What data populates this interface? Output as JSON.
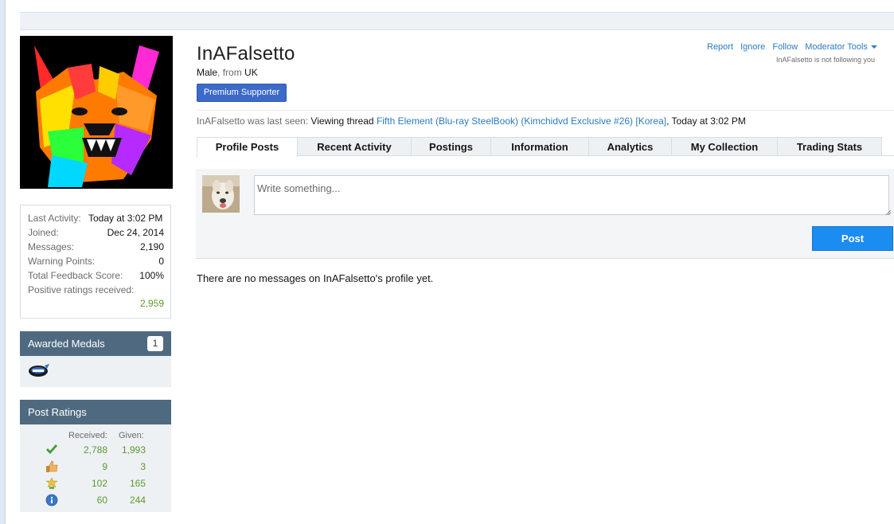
{
  "profile": {
    "username": "InAFalsetto",
    "gender": "Male",
    "from_word": "from",
    "location": "UK",
    "badge": "Premium Supporter"
  },
  "actions": {
    "report": "Report",
    "ignore": "Ignore",
    "follow": "Follow",
    "moderator_tools": "Moderator Tools",
    "following_status": "InAFalsetto is not following you"
  },
  "last_seen": {
    "prefix": "InAFalsetto was last seen:",
    "action": "Viewing thread",
    "thread": "Fifth Element (Blu-ray SteelBook) (Kimchidvd Exclusive #26) [Korea]",
    "time": ", Today at 3:02 PM"
  },
  "tabs": [
    {
      "label": "Profile Posts",
      "active": true
    },
    {
      "label": "Recent Activity"
    },
    {
      "label": "Postings"
    },
    {
      "label": "Information"
    },
    {
      "label": "Analytics"
    },
    {
      "label": "My Collection"
    },
    {
      "label": "Trading Stats"
    }
  ],
  "stats": [
    {
      "label": "Last Activity:",
      "value": "Today at 3:02 PM"
    },
    {
      "label": "Joined:",
      "value": "Dec 24, 2014"
    },
    {
      "label": "Messages:",
      "value": "2,190"
    },
    {
      "label": "Warning Points:",
      "value": "0"
    },
    {
      "label": "Total Feedback Score:",
      "value": "100%"
    },
    {
      "label": "Positive ratings received:",
      "value": "2,959"
    }
  ],
  "medals": {
    "title": "Awarded Medals",
    "count": "1",
    "icon": "medal-icon"
  },
  "ratings": {
    "title": "Post Ratings",
    "received_label": "Received:",
    "given_label": "Given:",
    "rows": [
      {
        "icon": "check-icon",
        "received": "2,788",
        "given": "1,993"
      },
      {
        "icon": "thumbs-up-icon",
        "received": "9",
        "given": "3"
      },
      {
        "icon": "award-icon",
        "received": "102",
        "given": "165"
      },
      {
        "icon": "info-icon",
        "received": "60",
        "given": "244"
      }
    ]
  },
  "composer": {
    "placeholder": "Write something...",
    "post_label": "Post"
  },
  "empty_message": "There are no messages on InAFalsetto's profile yet.",
  "colors": {
    "accent": "#1b8cf0",
    "link": "#2b7bc1",
    "panel": "#4f6a80",
    "positive": "#5b9b2e"
  }
}
